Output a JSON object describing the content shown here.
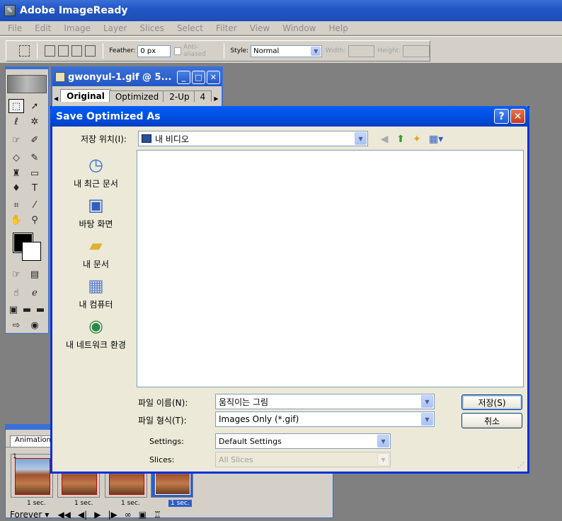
{
  "app": {
    "title": "Adobe ImageReady",
    "logo_glyph": "✎"
  },
  "menubar": [
    "File",
    "Edit",
    "Image",
    "Layer",
    "Slices",
    "Select",
    "Filter",
    "View",
    "Window",
    "Help"
  ],
  "options": {
    "feather_label": "Feather:",
    "feather_value": "0 px",
    "anti_aliased": "Anti-aliased",
    "style_label": "Style:",
    "style_value": "Normal",
    "width_label": "Width:",
    "height_label": "Height:"
  },
  "document": {
    "title": "gwonyul-1.gif @ 5...",
    "tabs": [
      "Original",
      "Optimized",
      "2-Up",
      "4"
    ]
  },
  "animation": {
    "tab": "Animation",
    "frames": [
      {
        "number": "1",
        "delay": "1 sec."
      },
      {
        "number": "2",
        "delay": "1 sec."
      },
      {
        "number": "3",
        "delay": "1 sec."
      },
      {
        "number": "4",
        "delay": "1 sec."
      }
    ],
    "loop": "Forever"
  },
  "dialog": {
    "title": "Save Optimized As",
    "save_in_label": "저장 위치(I):",
    "save_in_value": "내 비디오",
    "places": [
      {
        "label": "내 최근 문서",
        "icon": "recent-documents-icon"
      },
      {
        "label": "바탕 화면",
        "icon": "desktop-icon"
      },
      {
        "label": "내 문서",
        "icon": "my-documents-icon"
      },
      {
        "label": "내 컴퓨터",
        "icon": "my-computer-icon"
      },
      {
        "label": "내 네트워크 환경",
        "icon": "network-places-icon"
      }
    ],
    "filename_label": "파일 이름(N):",
    "filename_value": "움직이는 그림",
    "filetype_label": "파일 형식(T):",
    "filetype_value": "Images Only (*.gif)",
    "settings_label": "Settings:",
    "settings_value": "Default Settings",
    "slices_label": "Slices:",
    "slices_value": "All Slices",
    "save_button": "저장(S)",
    "cancel_button": "취소",
    "help_glyph": "?",
    "close_glyph": "✕"
  }
}
